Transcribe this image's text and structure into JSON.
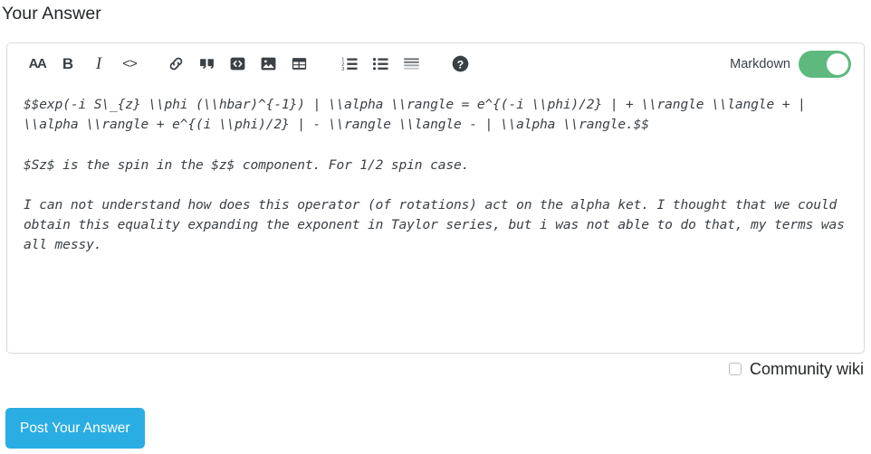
{
  "heading": {
    "title": "Your Answer"
  },
  "toolbar": {
    "groups": [
      {
        "name": "formatting",
        "buttons": [
          {
            "id": "heading",
            "icon": "heading-text-icon",
            "label": "AA",
            "title": "Heading"
          },
          {
            "id": "bold",
            "icon": "bold-icon",
            "label": "B",
            "title": "Bold"
          },
          {
            "id": "italic",
            "icon": "italic-icon",
            "label": "I",
            "title": "Italic"
          },
          {
            "id": "inline-code",
            "icon": "inline-code-icon",
            "label": "<>",
            "title": "Inline code"
          }
        ]
      },
      {
        "name": "insert",
        "buttons": [
          {
            "id": "link",
            "icon": "link-chain-icon",
            "label": "",
            "title": "Link"
          },
          {
            "id": "blockquote",
            "icon": "quote-icon",
            "label": "",
            "title": "Blockquote"
          },
          {
            "id": "code-block",
            "icon": "code-block-icon",
            "label": "",
            "title": "Code block"
          },
          {
            "id": "image",
            "icon": "image-icon",
            "label": "",
            "title": "Image"
          },
          {
            "id": "table",
            "icon": "table-icon",
            "label": "",
            "title": "Table"
          }
        ]
      },
      {
        "name": "lists",
        "buttons": [
          {
            "id": "ordered-list",
            "icon": "ordered-list-icon",
            "label": "",
            "title": "Numbered list"
          },
          {
            "id": "bullet-list",
            "icon": "bullet-list-icon",
            "label": "",
            "title": "Bulleted list"
          },
          {
            "id": "horizontal-rule",
            "icon": "horizontal-rule-icon",
            "label": "",
            "title": "Horizontal rule"
          }
        ]
      },
      {
        "name": "help",
        "buttons": [
          {
            "id": "help",
            "icon": "help-circle-icon",
            "label": "",
            "title": "Help"
          }
        ]
      }
    ],
    "markdown": {
      "label": "Markdown",
      "enabled": true,
      "on_color": "#5eb97f",
      "knob_color": "#ffffff"
    }
  },
  "editor": {
    "value": "$$exp(-i S\\_{z} \\\\phi (\\\\hbar)^{-1}) | \\\\alpha \\\\rangle = e^{(-i \\\\phi)/2} | + \\\\rangle \\\\langle + | \\\\alpha \\\\rangle + e^{(i \\\\phi)/2} | - \\\\rangle \\\\langle - | \\\\alpha \\\\rangle.$$\n\n$Sz$ is the spin in the $z$ component. For 1/2 spin case.\n\nI can not understand how does this operator (of rotations) act on the alpha ket. I thought that we could obtain this equality expanding the exponent in Taylor series, but i was not able to do that, my terms was all messy.",
    "placeholder": "",
    "border_color": "#d6d9dc",
    "text_color": "#3b4045"
  },
  "options": {
    "community_wiki": {
      "label": "Community wiki",
      "checked": false
    }
  },
  "actions": {
    "post_answer": {
      "label": "Post Your Answer",
      "color": "#2aade3",
      "text_color": "#ffffff"
    }
  }
}
